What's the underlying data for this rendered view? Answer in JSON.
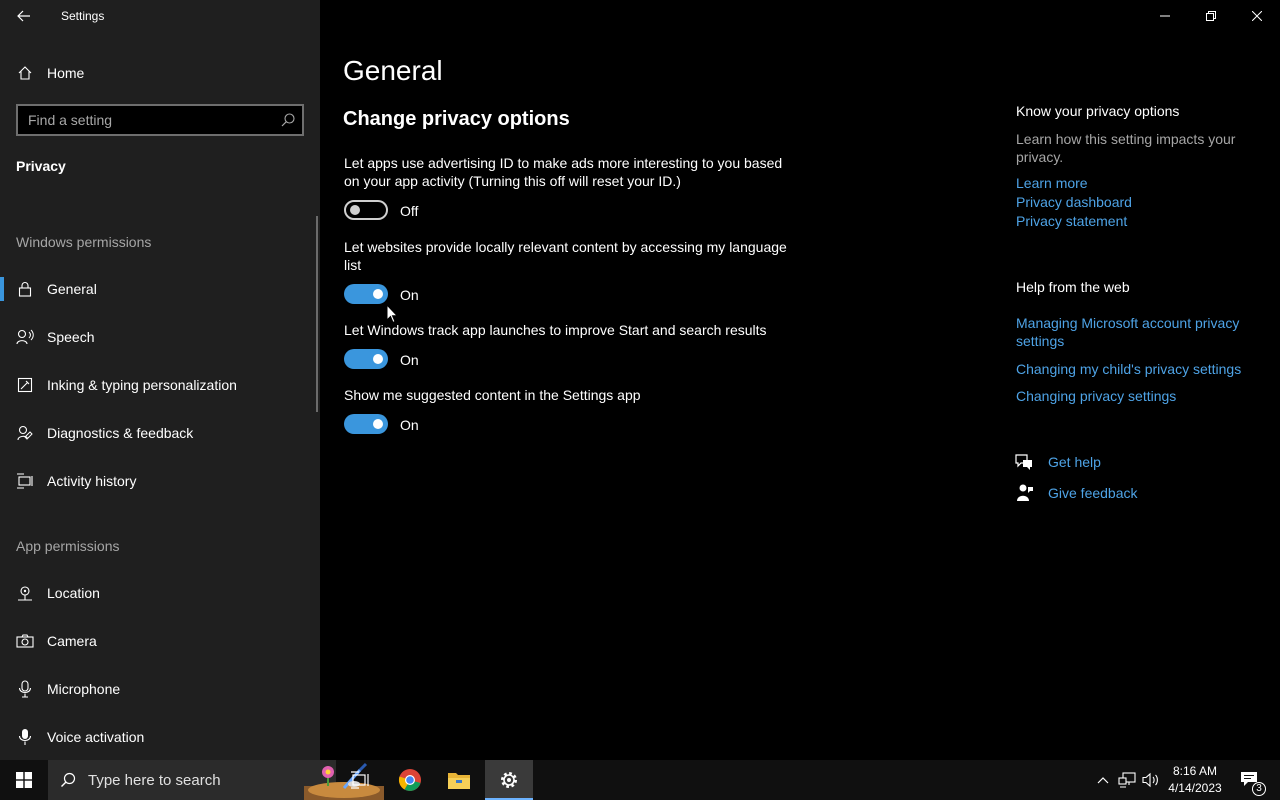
{
  "window": {
    "title": "Settings"
  },
  "sidebar": {
    "home_label": "Home",
    "search_placeholder": "Find a setting",
    "current_section": "Privacy",
    "windows_permissions_heading": "Windows permissions",
    "windows_permissions_items": [
      {
        "label": "General",
        "icon": "lock-icon",
        "active": true
      },
      {
        "label": "Speech",
        "icon": "speech-icon"
      },
      {
        "label": "Inking & typing personalization",
        "icon": "inking-icon"
      },
      {
        "label": "Diagnostics & feedback",
        "icon": "diagnostics-icon"
      },
      {
        "label": "Activity history",
        "icon": "activity-history-icon"
      }
    ],
    "app_permissions_heading": "App permissions",
    "app_permissions_items": [
      {
        "label": "Location",
        "icon": "location-icon"
      },
      {
        "label": "Camera",
        "icon": "camera-icon"
      },
      {
        "label": "Microphone",
        "icon": "microphone-icon"
      },
      {
        "label": "Voice activation",
        "icon": "voice-activation-icon"
      }
    ]
  },
  "main": {
    "title": "General",
    "subtitle": "Change privacy options",
    "options": [
      {
        "description": "Let apps use advertising ID to make ads more interesting to you based on your app activity (Turning this off will reset your ID.)",
        "state": "Off",
        "on": false
      },
      {
        "description": "Let websites provide locally relevant content by accessing my language list",
        "state": "On",
        "on": true
      },
      {
        "description": "Let Windows track app launches to improve Start and search results",
        "state": "On",
        "on": true
      },
      {
        "description": "Show me suggested content in the Settings app",
        "state": "On",
        "on": true
      }
    ]
  },
  "right_column": {
    "know_heading": "Know your privacy options",
    "know_text": "Learn how this setting impacts your privacy.",
    "know_links": [
      "Learn more",
      "Privacy dashboard",
      "Privacy statement"
    ],
    "help_heading": "Help from the web",
    "help_links": [
      "Managing Microsoft account privacy settings",
      "Changing my child's privacy settings",
      "Changing privacy settings"
    ],
    "get_help": "Get help",
    "give_feedback": "Give feedback"
  },
  "taskbar": {
    "search_placeholder": "Type here to search",
    "time": "8:16 AM",
    "date": "4/14/2023",
    "notification_count": "3"
  },
  "colors": {
    "accent": "#3a96dd",
    "link": "#4ea3e6",
    "sidebar_bg": "#1f1f1f",
    "main_bg": "#000000"
  }
}
